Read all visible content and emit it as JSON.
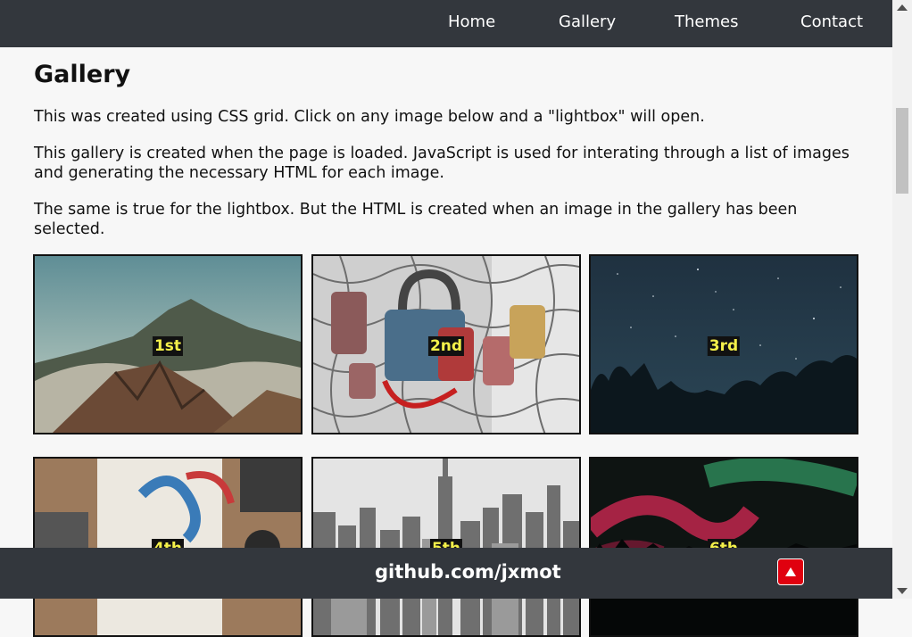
{
  "nav": {
    "items": [
      {
        "label": "Home"
      },
      {
        "label": "Gallery"
      },
      {
        "label": "Themes"
      },
      {
        "label": "Contact"
      }
    ]
  },
  "main": {
    "title": "Gallery",
    "paragraphs": [
      "This was created using CSS grid. Click on any image below and a \"lightbox\" will open.",
      "This gallery is created when the page is loaded. JavaScript is used for interating through a list of images and generating the necessary HTML for each image.",
      "The same is true for the lightbox. But the HTML is created when an image in the gallery has been selected."
    ]
  },
  "gallery": {
    "items": [
      {
        "label": "1st",
        "icon": "mountain-landscape-image"
      },
      {
        "label": "2nd",
        "icon": "padlocks-image"
      },
      {
        "label": "3rd",
        "icon": "starry-night-image"
      },
      {
        "label": "4th",
        "icon": "desk-items-image"
      },
      {
        "label": "5th",
        "icon": "city-skyline-image"
      },
      {
        "label": "6th",
        "icon": "aurora-image"
      }
    ]
  },
  "footer": {
    "link": "github.com/jxmot",
    "top_button_icon": "arrow-up-icon"
  },
  "colors": {
    "navbar_bg": "#33373d",
    "caption_text": "#f4f04a",
    "top_button": "#e0000f"
  }
}
